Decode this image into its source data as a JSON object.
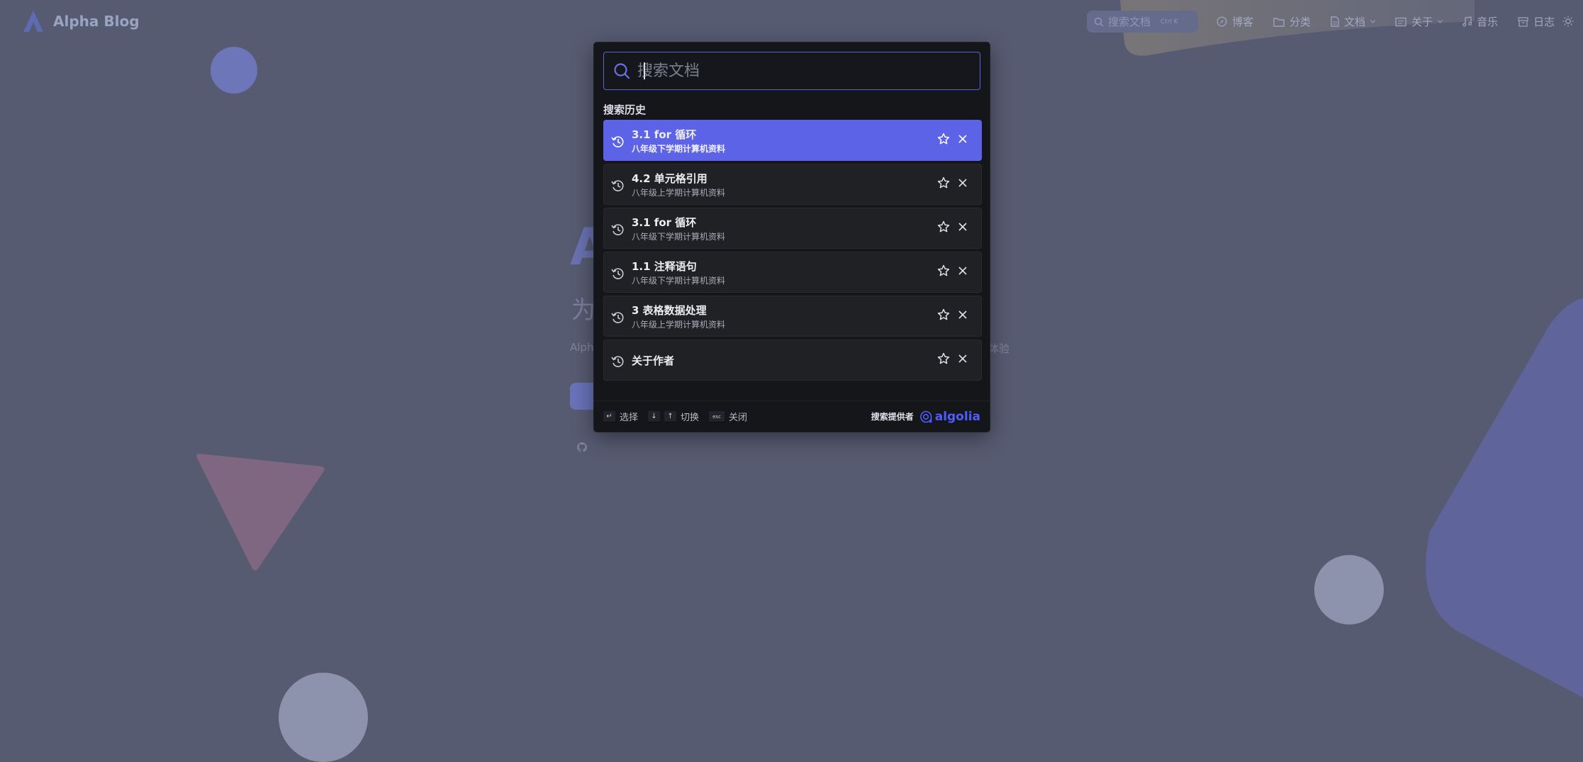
{
  "nav": {
    "brand": "Alpha Blog",
    "search_placeholder": "搜索文档",
    "search_shortcut": "Ctrl  K",
    "links": [
      {
        "label": "博客",
        "icon": "compass-icon"
      },
      {
        "label": "分类",
        "icon": "folder-icon"
      },
      {
        "label": "文档",
        "icon": "document-icon",
        "dropdown": true
      },
      {
        "label": "关于",
        "icon": "id-card-icon",
        "dropdown": true
      },
      {
        "label": "音乐",
        "icon": "music-note-icon"
      },
      {
        "label": "日志",
        "icon": "archive-icon"
      }
    ],
    "theme_icon": "sun-icon"
  },
  "hero": {
    "letter": "A",
    "subtitle_start": "为",
    "small_left": "Alph",
    "small_right": "体验"
  },
  "search_modal": {
    "placeholder": "搜索文档",
    "section_title": "搜索历史",
    "history": [
      {
        "title": "3.1 for 循环",
        "subtitle": "八年级下学期计算机资料",
        "active": true
      },
      {
        "title": "4.2 单元格引用",
        "subtitle": "八年级上学期计算机资料",
        "active": false
      },
      {
        "title": "3.1 for 循环",
        "subtitle": "八年级下学期计算机资料",
        "active": false
      },
      {
        "title": "1.1 注释语句",
        "subtitle": "八年级下学期计算机资料",
        "active": false
      },
      {
        "title": "3 表格数据处理",
        "subtitle": "八年级上学期计算机资料",
        "active": false
      },
      {
        "title": "关于作者",
        "subtitle": "",
        "active": false
      }
    ],
    "footer": {
      "select_key": "↵",
      "select_label": "选择",
      "down_key": "↓",
      "up_key": "↑",
      "switch_label": "切换",
      "esc_key": "esc",
      "close_label": "关闭",
      "provider_label": "搜索提供者",
      "provider_name": "algolia"
    }
  },
  "colors": {
    "background": "#575b72",
    "accent": "#5d63e6",
    "modal": "#15161a",
    "algolia": "#4f5dff"
  }
}
